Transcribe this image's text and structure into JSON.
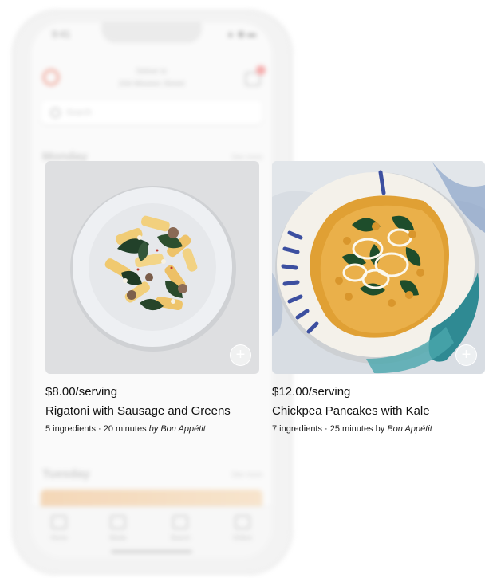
{
  "phone": {
    "status_time": "9:41",
    "status_icons": "▲ ◉ ▬",
    "deliver_label": "Deliver to",
    "deliver_address": "234 Mission Street",
    "search_placeholder": "Search",
    "days": [
      {
        "heading": "Monday",
        "link": "See more"
      },
      {
        "heading": "Tuesday",
        "link": "See more"
      }
    ],
    "tabs": [
      "Home",
      "Meals",
      "Search",
      "Orders"
    ]
  },
  "cards": [
    {
      "price": "$8.00/serving",
      "title": "Rigatoni with Sausage and Greens",
      "meta_prefix": "5 ingredients · 20 minutes ",
      "meta_by": "by",
      "meta_source": "Bon Appétit",
      "add_label": "+"
    },
    {
      "price": "$12.00/serving",
      "title": "Chickpea Pancakes with Kale",
      "meta_prefix": "7 ingredients · 25 minutes by ",
      "meta_by": "",
      "meta_source": "Bon Appétit",
      "add_label": "+"
    }
  ],
  "colors": {
    "background": "#ffffff",
    "text": "#111111",
    "plate_left_bg": "#dfe0e2",
    "plate_right_bg": "#d9dfe6"
  },
  "icons": [
    "search-icon",
    "cart-icon",
    "plus-icon",
    "home-tab-icon",
    "meals-tab-icon",
    "search-tab-icon",
    "orders-tab-icon"
  ]
}
